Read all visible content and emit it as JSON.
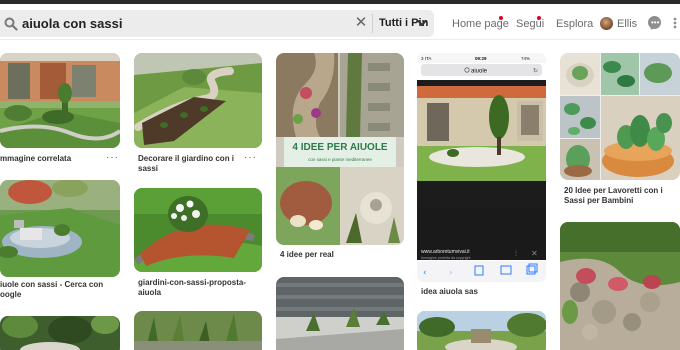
{
  "header": {
    "search_query": "aiuola con sassi",
    "filter_label": "Tutti i Pin",
    "nav": [
      {
        "label": "Home page"
      },
      {
        "label": "Segui"
      },
      {
        "label": "Esplora"
      }
    ],
    "user_name": "Ellis"
  },
  "pins": [
    {
      "caption_line1": "mmagine correlata",
      "caption_line2": ""
    },
    {
      "caption_line1": "iuole con sassi - Cerca con",
      "caption_line2": "oogle"
    },
    {
      "caption_line1": "Decorare il giardino con i",
      "caption_line2": "sassi"
    },
    {
      "caption_line1": "giardini-con-sassi-proposta-",
      "caption_line2": "aiuola"
    },
    {
      "caption_line1": "4 idee per real",
      "caption_line2": ""
    },
    {
      "caption_line1": "idea aiuola sas",
      "caption_line2": ""
    },
    {
      "caption_line1": "20 Idee per Lavoretti con i",
      "caption_line2": "Sassi per Bambini"
    }
  ],
  "overlay": {
    "banner_line1": "4 IDEE PER AIUOLE",
    "banner_line2": "con sassi e piante mediterranee"
  },
  "phone": {
    "carrier": "3 ITA",
    "time": "09:29",
    "battery": "74%",
    "url": "aiuole",
    "site": "www.arboretumvivai.it",
    "site_sub": "Immagine protetta da copyright"
  },
  "more_label": "···",
  "colors": {
    "accent": "#e60023",
    "search_bg": "#ececec",
    "nav_text": "#6b6b6b"
  }
}
